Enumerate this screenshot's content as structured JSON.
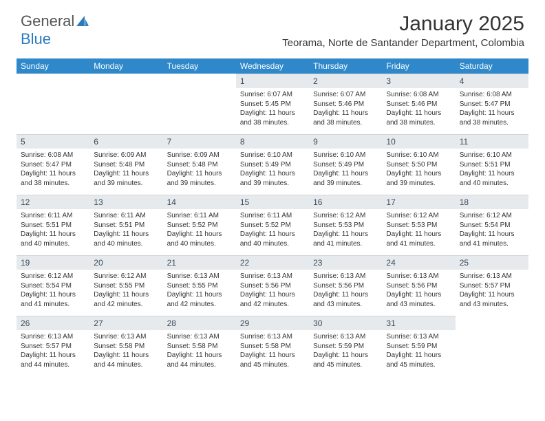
{
  "logo": {
    "text1": "General",
    "text2": "Blue"
  },
  "title": "January 2025",
  "location": "Teorama, Norte de Santander Department, Colombia",
  "weekdays": [
    "Sunday",
    "Monday",
    "Tuesday",
    "Wednesday",
    "Thursday",
    "Friday",
    "Saturday"
  ],
  "startOffset": 3,
  "days": [
    {
      "n": 1,
      "sr": "6:07 AM",
      "ss": "5:45 PM",
      "dl": "11 hours and 38 minutes."
    },
    {
      "n": 2,
      "sr": "6:07 AM",
      "ss": "5:46 PM",
      "dl": "11 hours and 38 minutes."
    },
    {
      "n": 3,
      "sr": "6:08 AM",
      "ss": "5:46 PM",
      "dl": "11 hours and 38 minutes."
    },
    {
      "n": 4,
      "sr": "6:08 AM",
      "ss": "5:47 PM",
      "dl": "11 hours and 38 minutes."
    },
    {
      "n": 5,
      "sr": "6:08 AM",
      "ss": "5:47 PM",
      "dl": "11 hours and 38 minutes."
    },
    {
      "n": 6,
      "sr": "6:09 AM",
      "ss": "5:48 PM",
      "dl": "11 hours and 39 minutes."
    },
    {
      "n": 7,
      "sr": "6:09 AM",
      "ss": "5:48 PM",
      "dl": "11 hours and 39 minutes."
    },
    {
      "n": 8,
      "sr": "6:10 AM",
      "ss": "5:49 PM",
      "dl": "11 hours and 39 minutes."
    },
    {
      "n": 9,
      "sr": "6:10 AM",
      "ss": "5:49 PM",
      "dl": "11 hours and 39 minutes."
    },
    {
      "n": 10,
      "sr": "6:10 AM",
      "ss": "5:50 PM",
      "dl": "11 hours and 39 minutes."
    },
    {
      "n": 11,
      "sr": "6:10 AM",
      "ss": "5:51 PM",
      "dl": "11 hours and 40 minutes."
    },
    {
      "n": 12,
      "sr": "6:11 AM",
      "ss": "5:51 PM",
      "dl": "11 hours and 40 minutes."
    },
    {
      "n": 13,
      "sr": "6:11 AM",
      "ss": "5:51 PM",
      "dl": "11 hours and 40 minutes."
    },
    {
      "n": 14,
      "sr": "6:11 AM",
      "ss": "5:52 PM",
      "dl": "11 hours and 40 minutes."
    },
    {
      "n": 15,
      "sr": "6:11 AM",
      "ss": "5:52 PM",
      "dl": "11 hours and 40 minutes."
    },
    {
      "n": 16,
      "sr": "6:12 AM",
      "ss": "5:53 PM",
      "dl": "11 hours and 41 minutes."
    },
    {
      "n": 17,
      "sr": "6:12 AM",
      "ss": "5:53 PM",
      "dl": "11 hours and 41 minutes."
    },
    {
      "n": 18,
      "sr": "6:12 AM",
      "ss": "5:54 PM",
      "dl": "11 hours and 41 minutes."
    },
    {
      "n": 19,
      "sr": "6:12 AM",
      "ss": "5:54 PM",
      "dl": "11 hours and 41 minutes."
    },
    {
      "n": 20,
      "sr": "6:12 AM",
      "ss": "5:55 PM",
      "dl": "11 hours and 42 minutes."
    },
    {
      "n": 21,
      "sr": "6:13 AM",
      "ss": "5:55 PM",
      "dl": "11 hours and 42 minutes."
    },
    {
      "n": 22,
      "sr": "6:13 AM",
      "ss": "5:56 PM",
      "dl": "11 hours and 42 minutes."
    },
    {
      "n": 23,
      "sr": "6:13 AM",
      "ss": "5:56 PM",
      "dl": "11 hours and 43 minutes."
    },
    {
      "n": 24,
      "sr": "6:13 AM",
      "ss": "5:56 PM",
      "dl": "11 hours and 43 minutes."
    },
    {
      "n": 25,
      "sr": "6:13 AM",
      "ss": "5:57 PM",
      "dl": "11 hours and 43 minutes."
    },
    {
      "n": 26,
      "sr": "6:13 AM",
      "ss": "5:57 PM",
      "dl": "11 hours and 44 minutes."
    },
    {
      "n": 27,
      "sr": "6:13 AM",
      "ss": "5:58 PM",
      "dl": "11 hours and 44 minutes."
    },
    {
      "n": 28,
      "sr": "6:13 AM",
      "ss": "5:58 PM",
      "dl": "11 hours and 44 minutes."
    },
    {
      "n": 29,
      "sr": "6:13 AM",
      "ss": "5:58 PM",
      "dl": "11 hours and 45 minutes."
    },
    {
      "n": 30,
      "sr": "6:13 AM",
      "ss": "5:59 PM",
      "dl": "11 hours and 45 minutes."
    },
    {
      "n": 31,
      "sr": "6:13 AM",
      "ss": "5:59 PM",
      "dl": "11 hours and 45 minutes."
    }
  ],
  "labels": {
    "sunrise": "Sunrise: ",
    "sunset": "Sunset: ",
    "daylight": "Daylight: "
  }
}
